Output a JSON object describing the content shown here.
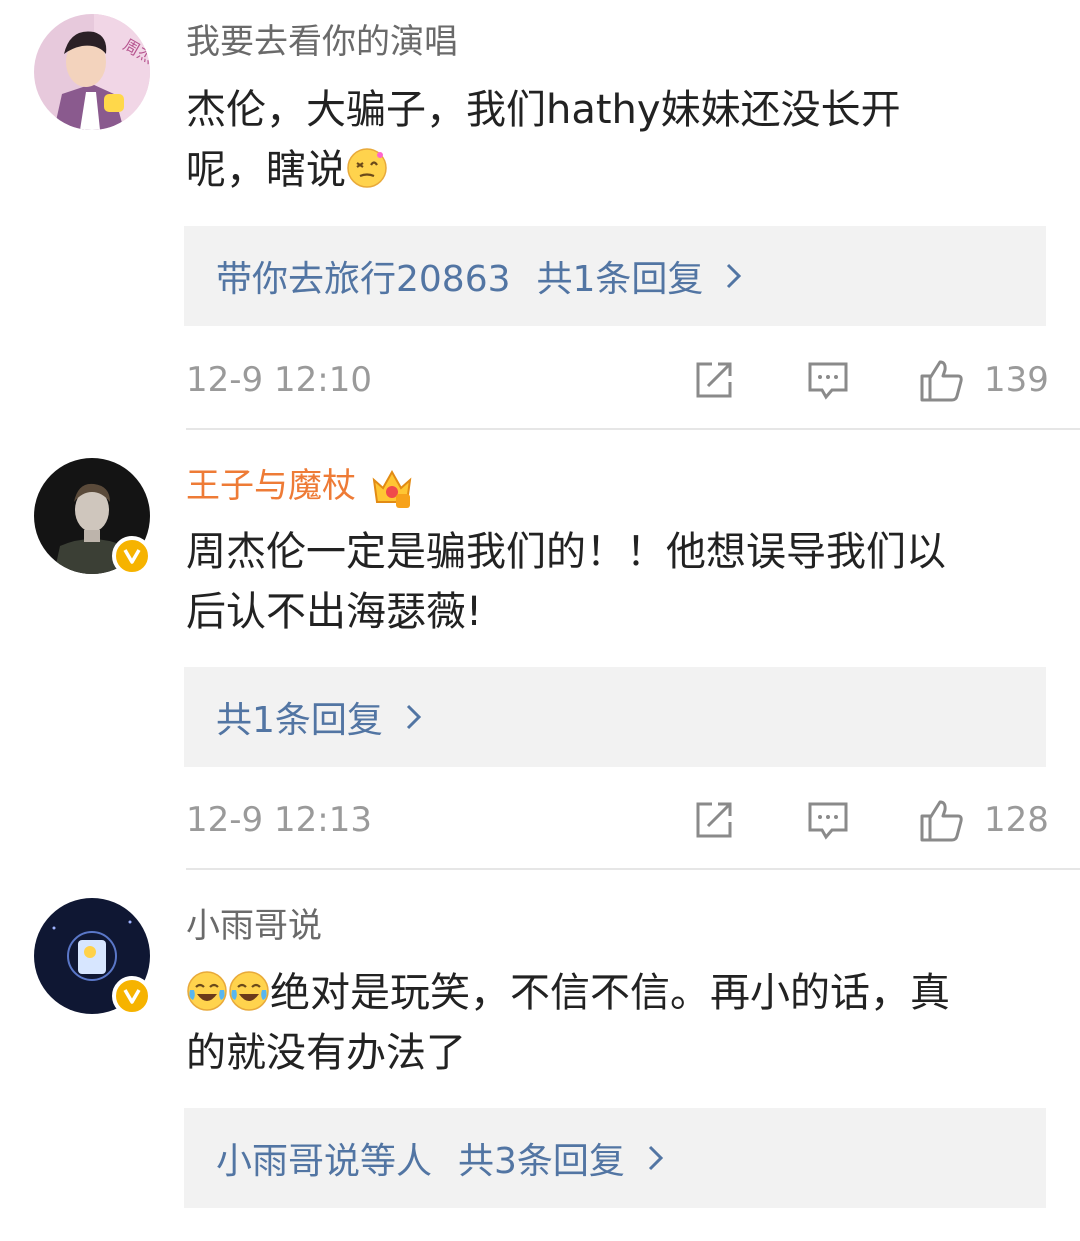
{
  "comments": [
    {
      "username": "我要去看你的演唱",
      "text_lines": [
        "杰伦，大骗子，我们hathy妹妹还没长开",
        "呢，瞎说"
      ],
      "reply_prefix": "带你去旅行20863",
      "reply_count": "共1条回复",
      "time": "12-9 12:10",
      "likes": "139",
      "avatar_badge_text": "周杰伦好屌"
    },
    {
      "username": "王子与魔杖",
      "text_lines": [
        "周杰伦一定是骗我们的！！他想误导我们以",
        "后认不出海瑟薇!"
      ],
      "reply_prefix": "",
      "reply_count": "共1条回复",
      "time": "12-9 12:13",
      "likes": "128"
    },
    {
      "username": "小雨哥说",
      "text_lines": [
        "绝对是玩笑，不信不信。再小的话，真",
        "的就没有办法了"
      ],
      "reply_prefix": "小雨哥说等人",
      "reply_count": "共3条回复",
      "time": "",
      "likes": ""
    }
  ],
  "icons": {
    "repost": "repost-icon",
    "comment": "comment-icon",
    "like": "thumbs-up-icon",
    "chevron": "chevron-right-icon",
    "verified": "verified-v-icon",
    "crown": "crown-icon"
  },
  "colors": {
    "link": "#5275a3",
    "vip_name": "#ee7b36",
    "meta": "#9a9a9a",
    "reply_bg": "#f2f2f2",
    "verified": "#f6b300"
  }
}
